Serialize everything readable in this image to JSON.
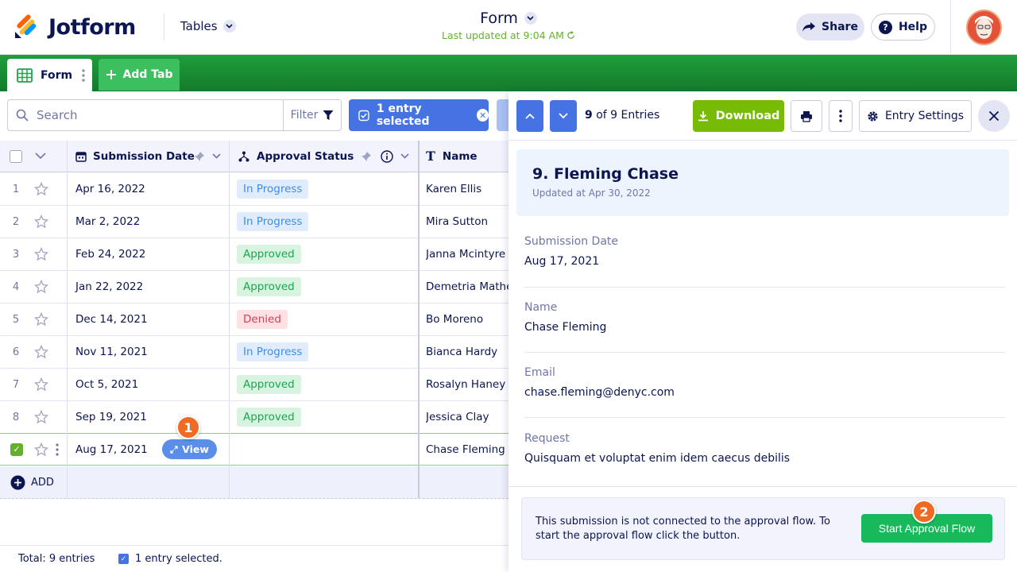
{
  "app": {
    "logo_text": "Jotform",
    "tables_menu": "Tables",
    "form_title": "Form",
    "last_updated": "Last updated at 9:04 AM",
    "share_label": "Share",
    "help_label": "Help"
  },
  "tabs": {
    "form_tab": "Form",
    "add_tab": "Add Tab"
  },
  "toolbar": {
    "search_placeholder": "Search",
    "filter_label": "Filter",
    "selected_label": "1 entry selected"
  },
  "table": {
    "columns": [
      "Submission Date",
      "Approval Status",
      "Name"
    ],
    "rows": [
      {
        "num": "1",
        "date": "Apr 16, 2022",
        "status": "In Progress",
        "name": "Karen Ellis"
      },
      {
        "num": "2",
        "date": "Mar 2, 2022",
        "status": "In Progress",
        "name": "Mira Sutton"
      },
      {
        "num": "3",
        "date": "Feb 24, 2022",
        "status": "Approved",
        "name": "Janna Mcintyre"
      },
      {
        "num": "4",
        "date": "Jan 22, 2022",
        "status": "Approved",
        "name": "Demetria Mathews"
      },
      {
        "num": "5",
        "date": "Dec 14, 2021",
        "status": "Denied",
        "name": "Bo Moreno"
      },
      {
        "num": "6",
        "date": "Nov 11, 2021",
        "status": "In Progress",
        "name": "Bianca Hardy"
      },
      {
        "num": "7",
        "date": "Oct 5, 2021",
        "status": "Approved",
        "name": "Rosalyn Haney"
      },
      {
        "num": "8",
        "date": "Sep 19, 2021",
        "status": "Approved",
        "name": "Jessica Clay"
      },
      {
        "num": "",
        "date": "Aug 17, 2021",
        "status": "",
        "name": "Chase Fleming"
      }
    ],
    "view_label": "View",
    "add_label": "ADD",
    "step1": "1"
  },
  "footer": {
    "total": "Total: 9 entries",
    "selected": "1 entry selected."
  },
  "panel": {
    "entries": "9",
    "entries_suffix": " of 9 Entries",
    "download_label": "Download",
    "entry_settings_label": "Entry Settings",
    "entry_title": "9. Fleming Chase",
    "entry_updated": "Updated at Apr 30, 2022",
    "fields": [
      {
        "label": "Submission Date",
        "value": "Aug 17, 2021"
      },
      {
        "label": "Name",
        "value": "Chase Fleming"
      },
      {
        "label": "Email",
        "value": "chase.fleming@denyc.com"
      },
      {
        "label": "Request",
        "value": "Quisquam et voluptat enim idem caecus debilis"
      }
    ],
    "approval_text": "This submission is not connected to the approval flow. To start the approval flow click the button.",
    "approval_button": "Start Approval Flow",
    "step2": "2"
  },
  "colors": {
    "brand_green": "#1e9e3c",
    "accent_blue": "#4573e3",
    "download_green": "#78bb07",
    "approve_green": "#18b95b",
    "step_orange": "#f06a24"
  }
}
